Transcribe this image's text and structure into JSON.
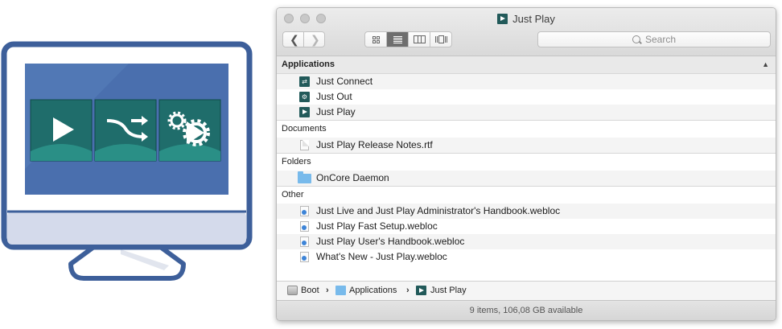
{
  "window": {
    "title": "Just Play",
    "search_placeholder": "Search",
    "status": "9 items, 106,08 GB available"
  },
  "sections": [
    {
      "header": "Applications",
      "items": [
        {
          "name": "Just Connect",
          "icon": "just-connect-icon"
        },
        {
          "name": "Just Out",
          "icon": "just-out-icon"
        },
        {
          "name": "Just Play",
          "icon": "just-play-icon"
        }
      ]
    },
    {
      "header": "Documents",
      "items": [
        {
          "name": "Just Play Release Notes.rtf",
          "icon": "document-icon"
        }
      ]
    },
    {
      "header": "Folders",
      "items": [
        {
          "name": "OnCore Daemon",
          "icon": "folder-icon"
        }
      ]
    },
    {
      "header": "Other",
      "items": [
        {
          "name": "Just Live and Just Play Administrator's Handbook.webloc",
          "icon": "webloc-icon"
        },
        {
          "name": "Just Play Fast Setup.webloc",
          "icon": "webloc-icon"
        },
        {
          "name": "Just Play User's Handbook.webloc",
          "icon": "webloc-icon"
        },
        {
          "name": "What's New - Just Play.webloc",
          "icon": "webloc-icon"
        }
      ]
    }
  ],
  "path": [
    "Boot",
    "Applications",
    "Just Play"
  ],
  "colors": {
    "monitor_blue": "#3d5f9a",
    "screen_blue": "#4a6fae",
    "tile_teal": "#1f6d6b",
    "app_icon": "#225a5a",
    "folder_blue": "#78baeb"
  }
}
